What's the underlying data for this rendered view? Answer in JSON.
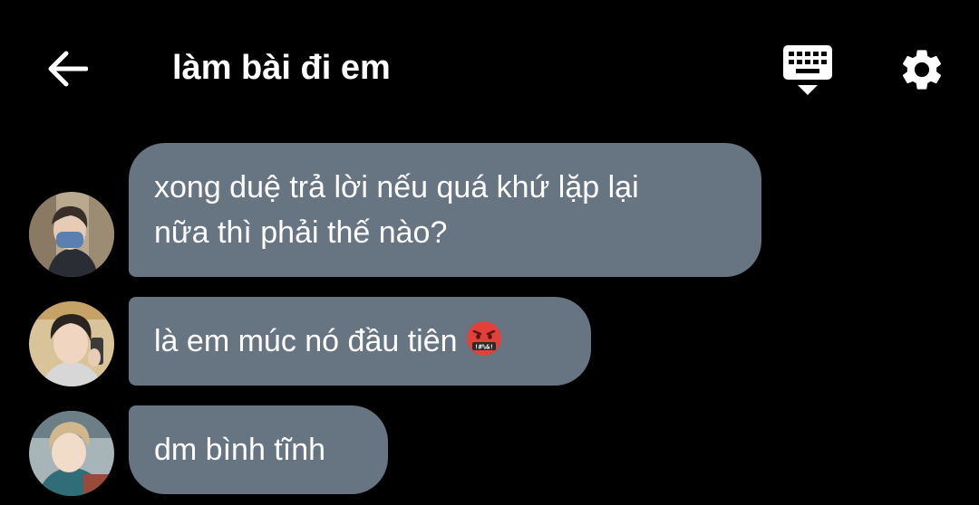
{
  "header": {
    "back_icon": "arrow-left-icon",
    "title": "làm bài đi em",
    "keyboard_icon": "keyboard-hide-icon",
    "settings_icon": "gear-icon"
  },
  "colors": {
    "background": "#000000",
    "bubble": "#677482",
    "text": "#ffffff"
  },
  "messages": [
    {
      "avatar_icon": "avatar-person-masked",
      "lines": [
        "xong duệ trả lời nếu quá khứ lặp lại",
        "nữa thì phải thế nào?"
      ]
    },
    {
      "avatar_icon": "avatar-person-selfie",
      "text": "là em múc nó đầu tiên",
      "emoji": "swearing-face-emoji"
    },
    {
      "avatar_icon": "avatar-person-blond",
      "text": "dm bình tĩnh"
    }
  ]
}
